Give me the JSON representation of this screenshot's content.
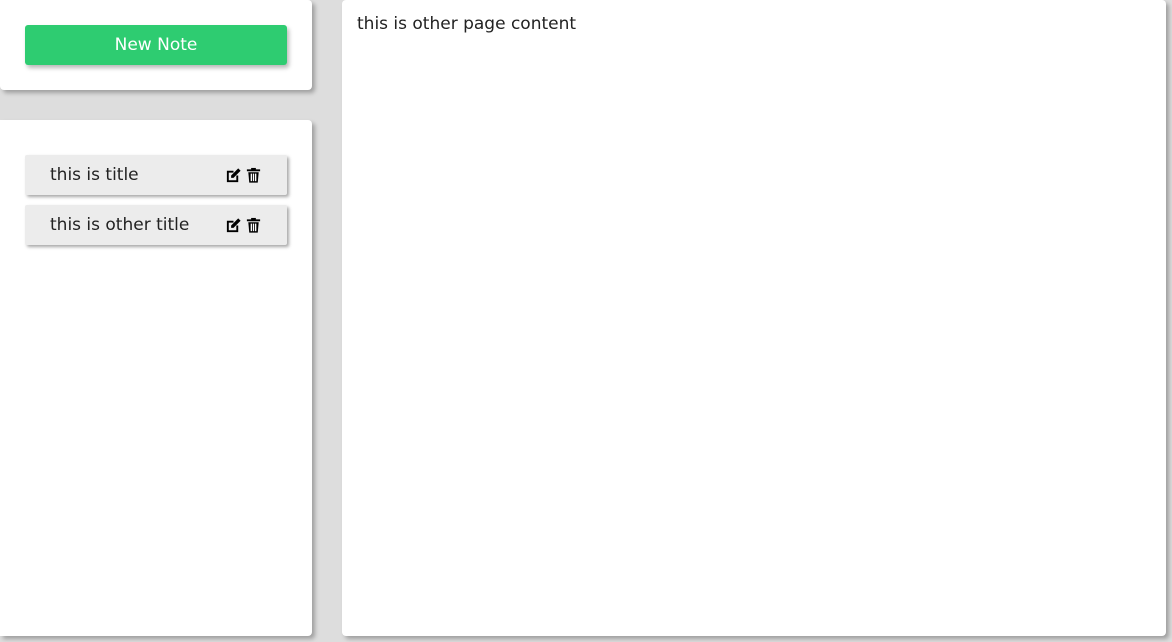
{
  "toolbar": {
    "new_note_label": "New Note"
  },
  "notes": [
    {
      "title": "this is title",
      "edit_icon": "edit-icon",
      "delete_icon": "trash-icon"
    },
    {
      "title": "this is other title",
      "edit_icon": "edit-icon",
      "delete_icon": "trash-icon"
    }
  ],
  "content": {
    "text": "this is other page content"
  },
  "colors": {
    "accent": "#2ecc71",
    "background": "#dddddd",
    "panel": "#ffffff",
    "note_item": "#ececec"
  }
}
